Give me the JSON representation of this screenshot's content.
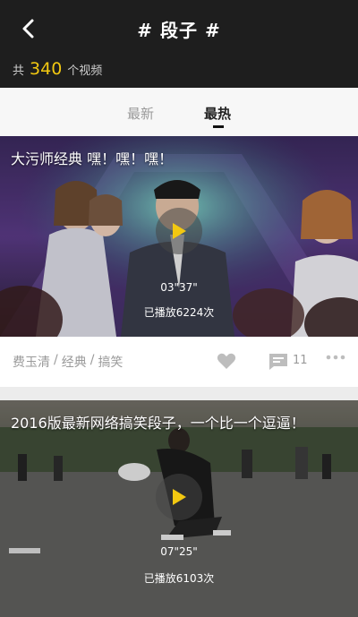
{
  "header": {
    "title": "# 段子 #",
    "count_prefix": "共",
    "count_value": "340",
    "count_suffix": "个视频"
  },
  "tabs": [
    {
      "label": "最新",
      "active": false
    },
    {
      "label": "最热",
      "active": true
    }
  ],
  "videos": [
    {
      "title": "大污师经典 嘿！嘿！嘿！",
      "duration": "03\"37\"",
      "plays": "已播放6224次",
      "tags": [
        "费玉清",
        "经典",
        "搞笑"
      ],
      "tag_separator": "/",
      "comments": "11"
    },
    {
      "title": "2016版最新网络搞笑段子，一个比一个逗逼！",
      "duration": "07\"25\"",
      "plays": "已播放6103次"
    }
  ],
  "colors": {
    "accent": "#f2c811",
    "header_bg": "#1e1e1e"
  },
  "icons": [
    "back-arrow-icon",
    "play-icon",
    "heart-icon",
    "comment-icon",
    "more-icon"
  ]
}
